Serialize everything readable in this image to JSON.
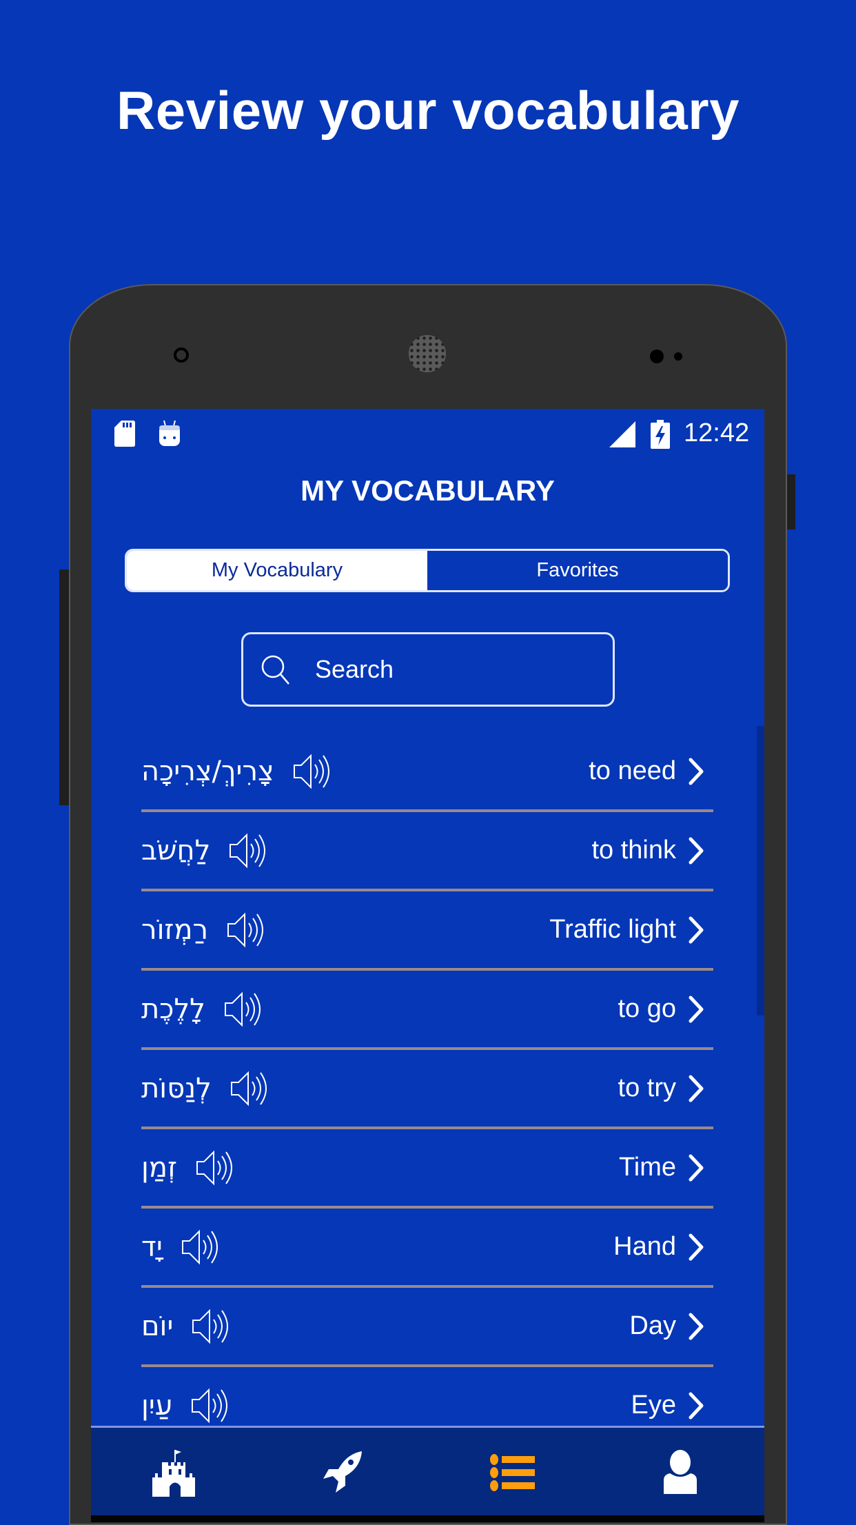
{
  "promo": {
    "headline": "Review your vocabulary"
  },
  "status_bar": {
    "icons": [
      "sd-card-icon",
      "android-bot-icon",
      "signal-icon",
      "battery-charging-icon"
    ],
    "time": "12:42"
  },
  "screen": {
    "title": "MY VOCABULARY",
    "tabs": [
      {
        "label": "My Vocabulary",
        "active": true
      },
      {
        "label": "Favorites",
        "active": false
      }
    ],
    "search": {
      "placeholder": "Search",
      "value": ""
    },
    "vocabulary": [
      {
        "hebrew": "צָרִיךְ/צְרִיכָה",
        "english": "to need"
      },
      {
        "hebrew": "לַחֲשֹׁב",
        "english": "to think"
      },
      {
        "hebrew": "רַמְזוֹר",
        "english": "Traffic light"
      },
      {
        "hebrew": "לָלֶכֶת",
        "english": "to go"
      },
      {
        "hebrew": "לְנַסּוֹת",
        "english": "to try"
      },
      {
        "hebrew": "זְמַן",
        "english": "Time"
      },
      {
        "hebrew": "יָד",
        "english": "Hand"
      },
      {
        "hebrew": "יוֹם",
        "english": "Day"
      },
      {
        "hebrew": "עַיִן",
        "english": "Eye"
      }
    ]
  },
  "bottom_nav": {
    "items": [
      {
        "icon": "castle-icon",
        "active": false
      },
      {
        "icon": "rocket-icon",
        "active": false
      },
      {
        "icon": "list-icon",
        "active": true
      },
      {
        "icon": "user-icon",
        "active": false
      }
    ]
  },
  "colors": {
    "background": "#0537b7",
    "nav_background": "#04297f",
    "active_accent": "#ff9e0d",
    "divider": "#9a8a8a",
    "text": "#ffffff",
    "tab_active_text": "#0a2a98"
  }
}
